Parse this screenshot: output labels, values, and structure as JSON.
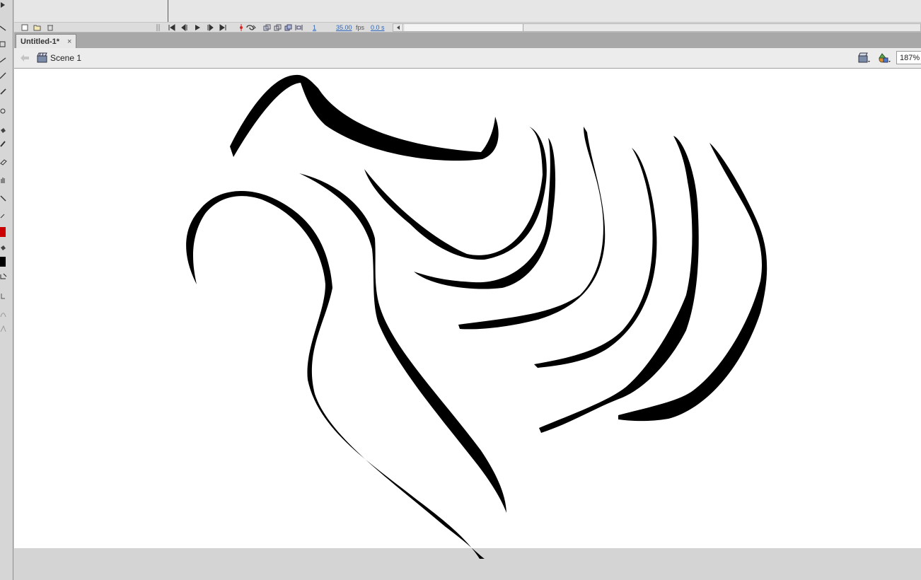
{
  "window": {
    "document_tab": "Untitled-1*",
    "close_glyph": "×"
  },
  "timeline": {
    "current_frame": "1",
    "frame_rate": "35.00",
    "fps_unit": "fps",
    "elapsed_time": "0.0 s",
    "controls": [
      "go-to-first-frame-icon",
      "step-back-icon",
      "play-icon",
      "step-forward-icon",
      "go-to-last-frame-icon",
      "center-frame-icon",
      "loop-icon",
      "onion-skin-icon",
      "onion-skin-outlines-icon",
      "edit-multiple-frames-icon",
      "modify-onion-markers-icon"
    ],
    "layer_buttons": [
      "new-layer-icon",
      "new-folder-icon",
      "delete-icon"
    ]
  },
  "edit_bar": {
    "scene_name": "Scene 1",
    "zoom": "187%"
  },
  "tools": {
    "stroke_color": "#000000",
    "fill_color": "#cc0000",
    "items": [
      "selection-tool-icon",
      "subselection-tool-icon",
      "free-transform-icon",
      "lasso-icon",
      "pen-icon",
      "text-icon",
      "line-icon",
      "rectangle-icon",
      "pencil-icon",
      "brush-icon",
      "deco-icon",
      "bone-icon",
      "paint-bucket-icon",
      "eyedropper-icon",
      "eraser-icon",
      "hand-icon",
      "zoom-icon"
    ]
  },
  "colors": {
    "stage": "#ffffff",
    "pasteboard": "#d4d4d4",
    "playhead": "#dd2222",
    "stroke": "#000000"
  }
}
